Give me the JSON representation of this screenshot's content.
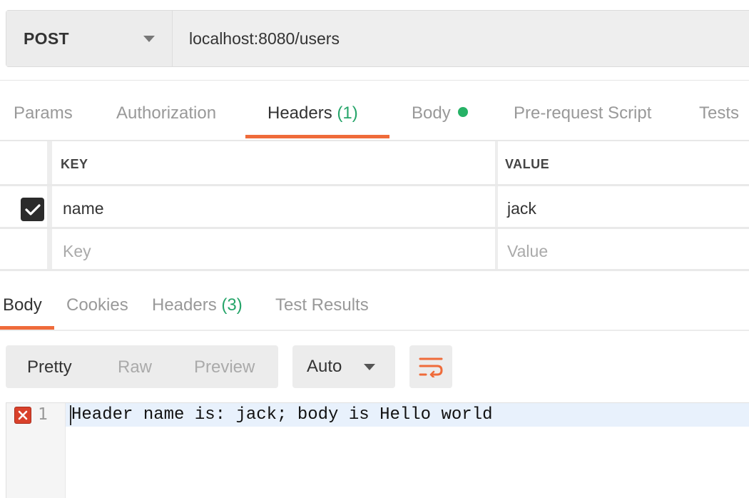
{
  "request": {
    "method": "POST",
    "url": "localhost:8080/users"
  },
  "request_tabs": [
    {
      "label": "Params",
      "count": ""
    },
    {
      "label": "Authorization",
      "count": ""
    },
    {
      "label": "Headers",
      "count": "(1)"
    },
    {
      "label": "Body",
      "count": ""
    },
    {
      "label": "Pre-request Script",
      "count": ""
    },
    {
      "label": "Tests",
      "count": ""
    }
  ],
  "active_request_tab": "Headers",
  "headers_table": {
    "columns": {
      "key": "KEY",
      "value": "VALUE"
    },
    "rows": [
      {
        "checked": true,
        "key": "name",
        "value": "jack"
      }
    ],
    "new_row": {
      "key_placeholder": "Key",
      "value_placeholder": "Value"
    }
  },
  "response_tabs": [
    {
      "label": "Body",
      "count": ""
    },
    {
      "label": "Cookies",
      "count": ""
    },
    {
      "label": "Headers",
      "count": "(3)"
    },
    {
      "label": "Test Results",
      "count": ""
    }
  ],
  "active_response_tab": "Body",
  "view_modes": [
    "Pretty",
    "Raw",
    "Preview"
  ],
  "active_view_mode": "Pretty",
  "format": "Auto",
  "editor": {
    "lines": [
      {
        "number": "1",
        "text": "Header name is: jack; body is Hello world",
        "error": true
      }
    ]
  },
  "colors": {
    "accent": "#ef6b3a",
    "count_green": "#26a56a",
    "body_dot": "#26b266",
    "error_red": "#d9412b"
  },
  "icons": [
    "chevron-down-icon",
    "body-indicator-dot-icon",
    "check-icon",
    "wrap-lines-icon",
    "error-icon"
  ]
}
